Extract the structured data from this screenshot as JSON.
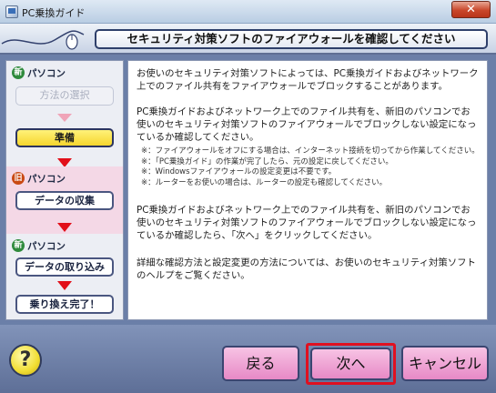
{
  "window": {
    "title": "PC乗換ガイド",
    "close_label": "✕"
  },
  "header": {
    "title": "セキュリティ対策ソフトのファイアウォールを確認してください"
  },
  "steps": {
    "new_pc_1": {
      "badge": "新",
      "label": "パソコン",
      "items": [
        {
          "label": "方法の選択",
          "state": "disabled"
        },
        {
          "label": "準備",
          "state": "active"
        }
      ]
    },
    "old_pc": {
      "badge": "旧",
      "label": "パソコン",
      "items": [
        {
          "label": "データの収集",
          "state": "normal"
        }
      ]
    },
    "new_pc_2": {
      "badge": "新",
      "label": "パソコン",
      "items": [
        {
          "label": "データの取り込み",
          "state": "normal"
        },
        {
          "label": "乗り換え完了！",
          "state": "normal"
        }
      ]
    }
  },
  "content": {
    "paragraph1": "お使いのセキュリティ対策ソフトによっては、PC乗換ガイドおよびネットワーク上でのファイル共有をファイアウォールでブロックすることがあります。",
    "paragraph2": "PC乗換ガイドおよびネットワーク上でのファイル共有を、新旧のパソコンでお使いのセキュリティ対策ソフトのファイアウォールでブロックしない設定になっているか確認してください。",
    "notes": [
      "※：ファイアウォールをオフにする場合は、インターネット接続を切ってから作業してください。",
      "※：「PC乗換ガイド」の作業が完了したら、元の設定に戻してください。",
      "※：Windowsファイアウォールの設定変更は不要です。",
      "※：ルーターをお使いの場合は、ルーターの設定も確認してください。"
    ],
    "paragraph3": "PC乗換ガイドおよびネットワーク上でのファイル共有を、新旧のパソコンでお使いのセキュリティ対策ソフトのファイアウォールでブロックしない設定になっているか確認したら、「次へ」をクリックしてください。",
    "paragraph4": "詳細な確認方法と設定変更の方法については、お使いのセキュリティ対策ソフトのヘルプをご覧ください。"
  },
  "footer": {
    "help_label": "?",
    "back_label": "戻る",
    "next_label": "次へ",
    "cancel_label": "キャンセル"
  },
  "colors": {
    "active_step": "#f6d62e",
    "old_pc_section": "#f4d8e6",
    "arrow": "#e2101a",
    "footer_button": "#e789c6",
    "highlight_frame": "#e01020"
  },
  "icons": {
    "app": "pc-transfer-app-icon",
    "header_decoration": "mouse-cable-icon",
    "help": "question-mark-icon"
  }
}
